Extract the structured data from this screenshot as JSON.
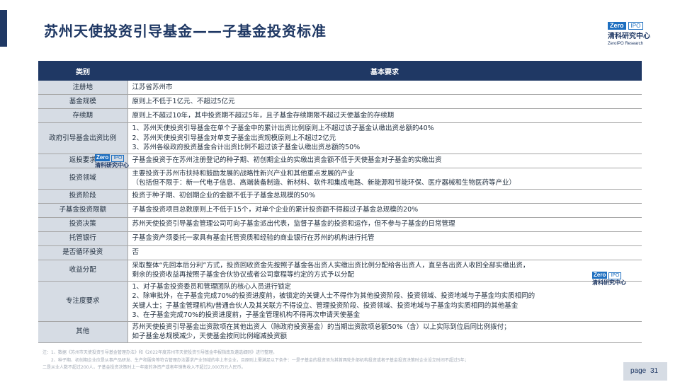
{
  "header": {
    "title": "苏州天使投资引导基金——子基金投资标准",
    "logo": {
      "badge_left": "Zero",
      "badge_right": "IPO",
      "cn": "清科研究中心",
      "en": "ZeroIPO Research"
    }
  },
  "table": {
    "columns": [
      "类别",
      "基本要求"
    ],
    "rows": [
      {
        "category": "注册地",
        "lines": [
          "江苏省苏州市"
        ]
      },
      {
        "category": "基金规模",
        "lines": [
          "原则上不低于1亿元、不超过5亿元"
        ]
      },
      {
        "category": "存续期",
        "lines": [
          "原则上不超过10年，其中投资期不超过5年，且子基金存续期限不超过天使基金的存续期"
        ]
      },
      {
        "category": "政府引导基金出资比例",
        "lines": [
          "1、苏州天使投资引导基金在单个子基金中的累计出资比例原则上不超过该子基金认缴出资总额的40%",
          "2、苏州天使投资引导基金对单支子基金出资规模原则上不超过2亿元",
          "3、苏州各级政府投资基金合计出资比例不超过该子基金认缴出资总额的50%"
        ]
      },
      {
        "category": "返投要求",
        "lines": [
          "子基金投资于在苏州注册登记的种子期、初创期企业的实缴出资金额不低于天使基金对子基金的实缴出资"
        ]
      },
      {
        "category": "投资领域",
        "lines": [
          "主要投资于苏州市扶持和鼓励发展的战略性新兴产业和其他重点发展的产业",
          "（包括但不限于：新一代电子信息、高端装备制造、新材料、软件和集成电路、新能源和节能环保、医疗器械和生物医药等产业）"
        ]
      },
      {
        "category": "投资阶段",
        "lines": [
          "投资于种子期、初创期企业的金额不低于子基金总规模的50%"
        ]
      },
      {
        "category": "子基金投资限额",
        "lines": [
          "子基金投资项目总数原则上不低于15个，对单个企业的累计投资额不得超过子基金总规模的20%"
        ]
      },
      {
        "category": "投资决策",
        "lines": [
          "苏州天使投资引导基金管理公司可向子基金派出代表，监督子基金的投资和运作，但不参与子基金的日常管理"
        ]
      },
      {
        "category": "托管银行",
        "lines": [
          "子基金资产须委托一家具有基金托管资质和经验的商业银行在苏州的机构进行托管"
        ]
      },
      {
        "category": "是否循环投资",
        "lines": [
          "否"
        ]
      },
      {
        "category": "收益分配",
        "lines": [
          "采取整体“先回本后分利”方式，投资回收资金先按照子基金各出资人实缴出资比例分配给各出资人，直至各出资人收回全部实缴出资，",
          "剩余的投资收益再按照子基金合伙协议或者公司章程等约定的方式予以分配"
        ]
      },
      {
        "category": "专注度要求",
        "lines": [
          "1、对子基金投资委员和管理团队的核心人员进行锁定",
          "2、除审批外，在子基金完成70%的投资进度前，被锁定的关键人士不得作为其他投资阶段、投资领域、投资地域与子基金均实质相同的",
          "关键人士；子基金管理机构/普通合伙人及其关联方不得设立、管理投资阶段、投资领域、投资地域与子基金均实质相同的其他基金",
          "3、在子基金完成70%的投资进度前，子基金管理机构不得再次申请天使基金"
        ]
      },
      {
        "category": "其他",
        "lines": [
          "苏州天使投资引导基金出资款项在其他出资人（除政府投资基金）的当期出资款项总额50%（含）以上实际到位后同比例拨付；",
          "如子基金总规模减少，天使基金按同比例缩减投资额"
        ]
      }
    ]
  },
  "notes": [
    "注：1、数据《苏州市天使投资引导基金管理办法》和《2022年度苏州市天使投资引导基金申报指南及遴选细则》进行整理。",
    "2、种子期、初创期企业应是从事产品研发、生产和服务等符合管理办法要求产业领域的非上市企业，且原则上需满足以下条件：一是子基金的投资须为其首两轮外部机构投资或者子基金投资决策时企业设立时间不超过5年；",
    "二是从业人数不超过200人，子基金投资决策时上一年度的净资产或者年销售收入不超过2,000万元人民币。"
  ],
  "page": {
    "label": "page",
    "number": "31"
  }
}
